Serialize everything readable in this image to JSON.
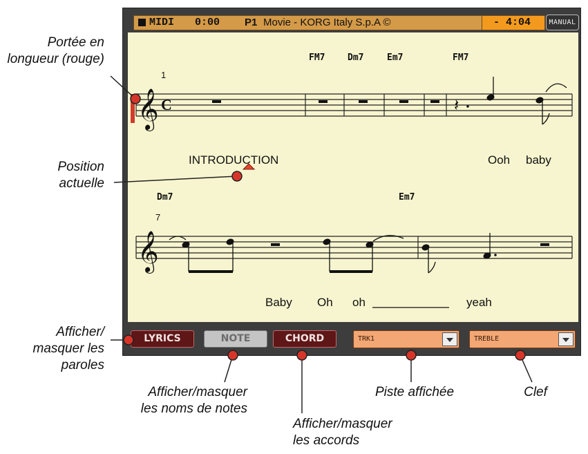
{
  "status_bar": {
    "mode": "MIDI",
    "time": "0:00",
    "program": "P1",
    "song_title": "Movie - KORG Italy S.p.A ©",
    "remaining": "- 4:04",
    "manual_button": "MANUAL"
  },
  "score": {
    "systems": [
      {
        "measure_number": "1",
        "time_signature": "C",
        "chords": [
          "FM7",
          "Dm7",
          "Em7",
          "FM7"
        ],
        "lyrics": [
          "INTRODUCTION",
          "Ooh",
          "baby"
        ]
      },
      {
        "measure_number": "7",
        "chords": [
          "Dm7",
          "Em7"
        ],
        "lyrics": [
          "Baby",
          "Oh",
          "oh",
          "yeah"
        ]
      }
    ]
  },
  "toolbar": {
    "lyrics_button": "LYRICS",
    "note_button": "NOTE",
    "chord_button": "CHORD",
    "track_select": "TRK1",
    "clef_select": "TREBLE"
  },
  "callouts": {
    "staff_length": [
      "Portée en",
      "longueur (rouge)"
    ],
    "current_position": [
      "Position",
      "actuelle"
    ],
    "toggle_lyrics": [
      "Afficher/",
      "masquer les",
      "paroles"
    ],
    "toggle_notes": [
      "Afficher/masquer",
      "les noms de notes"
    ],
    "toggle_chords": [
      "Afficher/masquer",
      "les accords"
    ],
    "displayed_track": "Piste affichée",
    "clef": "Clef"
  },
  "colors": {
    "status_bar": "#d49a48",
    "score_background": "#f7f5cf",
    "accent_red": "#d23a2a",
    "dark_button": "#5e1616",
    "select_fill": "#f2a774"
  }
}
